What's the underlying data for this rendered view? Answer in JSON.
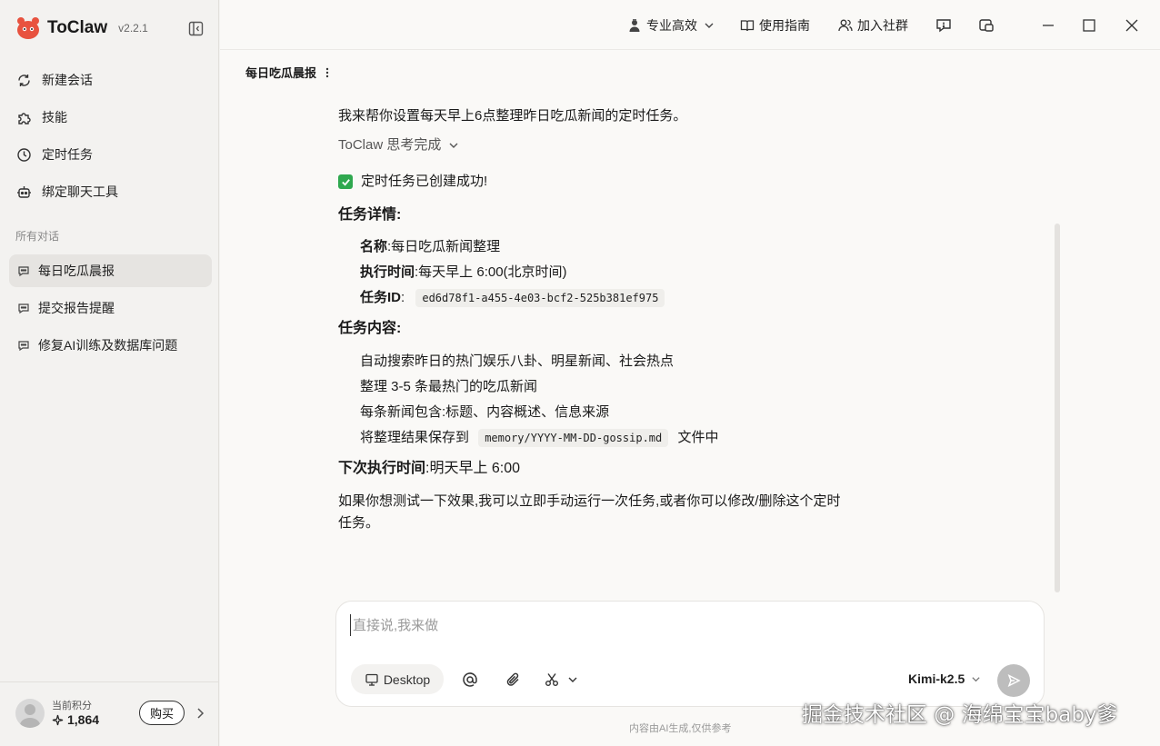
{
  "app": {
    "name": "ToClaw",
    "version": "v2.2.1"
  },
  "sidebar": {
    "nav": [
      {
        "label": "新建会话",
        "icon": "refresh-chat-icon"
      },
      {
        "label": "技能",
        "icon": "puzzle-icon"
      },
      {
        "label": "定时任务",
        "icon": "clock-icon"
      },
      {
        "label": "绑定聊天工具",
        "icon": "robot-icon"
      }
    ],
    "section_label": "所有对话",
    "conversations": [
      {
        "label": "每日吃瓜晨报",
        "active": true
      },
      {
        "label": "提交报告提醒",
        "active": false
      },
      {
        "label": "修复AI训练及数据库问题",
        "active": false
      }
    ],
    "bottom": {
      "points_label": "当前积分",
      "points_value": "1,864",
      "buy_label": "购买"
    }
  },
  "topbar": {
    "mode": "专业高效",
    "guide": "使用指南",
    "community": "加入社群"
  },
  "conversation": {
    "title": "每日吃瓜晨报",
    "intro": "我来帮你设置每天早上6点整理昨日吃瓜新闻的定时任务。",
    "thinking": "ToClaw 思考完成",
    "success": "定时任务已创建成功!",
    "details_heading": "任务详情:",
    "name_label": "名称",
    "name_value": ":每日吃瓜新闻整理",
    "time_label": "执行时间",
    "time_value": ":每天早上 6:00(北京时间)",
    "id_label": "任务ID",
    "id_sep": ":",
    "id_value": "ed6d78f1-a455-4e03-bcf2-525b381ef975",
    "content_heading": "任务内容:",
    "content_items": [
      "自动搜索昨日的热门娱乐八卦、明星新闻、社会热点",
      "整理 3-5 条最热门的吃瓜新闻",
      "每条新闻包含:标题、内容概述、信息来源"
    ],
    "save_prefix": "将整理结果保存到",
    "save_path": "memory/YYYY-MM-DD-gossip.md",
    "save_suffix": "文件中",
    "next_label": "下次执行时间",
    "next_value": ":明天早上 6:00",
    "closing_1": "如果你想测试一下效果,我可以立即手动运行一次任务,或者你可以修改/删除这个定时",
    "closing_2": "任务。"
  },
  "composer": {
    "placeholder": "直接说,我来做",
    "desktop_label": "Desktop",
    "model": "Kimi-k2.5"
  },
  "disclaimer": "内容由AI生成,仅供参考",
  "watermark": "掘金技术社区 @ 海绵宝宝baby爹"
}
